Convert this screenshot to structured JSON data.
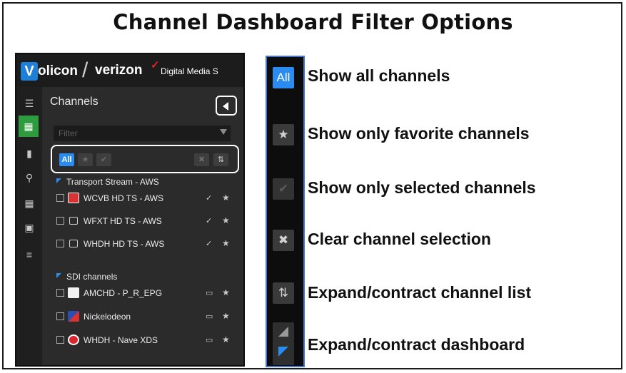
{
  "title": "Channel Dashboard Filter Options",
  "app": {
    "logo_v": "V",
    "logo_name": "olicon",
    "logo_slash": "/",
    "partner": "verizon",
    "partner_check": "✓",
    "product": "Digital Media S",
    "rail_icons": [
      "menu-icon",
      "film-icon",
      "bookmark-icon",
      "search-icon",
      "grid-icon",
      "share-icon",
      "list-icon"
    ],
    "panel_title": "Channels",
    "filter_placeholder": "Filter",
    "toolbar": {
      "all_label": "All",
      "star_glyph": "★",
      "check_glyph": "✔",
      "clear_glyph": "✖",
      "expand_glyph": "⇅"
    },
    "groups": [
      {
        "label": "Transport Stream - AWS",
        "channels": [
          {
            "label": "WCVB HD TS - AWS",
            "icon": "wcvb-logo-icon",
            "action": "✓"
          },
          {
            "label": "WFXT HD TS - AWS",
            "icon": "tv-icon",
            "action": "✓"
          },
          {
            "label": "WHDH HD TS - AWS",
            "icon": "tv-icon",
            "action": "✓"
          }
        ]
      },
      {
        "label": "SDI channels",
        "channels": [
          {
            "label": "AMCHD - P_R_EPG",
            "icon": "amc-logo-icon",
            "action": "▭"
          },
          {
            "label": "Nickelodeon",
            "icon": "nickelodeon-logo-icon",
            "action": "▭"
          },
          {
            "label": "WHDH - Nave XDS",
            "icon": "channel7-logo-icon",
            "action": "▭"
          }
        ]
      }
    ],
    "star": "★"
  },
  "legend": [
    {
      "icon": "all-button",
      "glyph": "All",
      "text": "Show all channels"
    },
    {
      "icon": "star-icon",
      "glyph": "★",
      "text": "Show only favorite channels"
    },
    {
      "icon": "check-icon",
      "glyph": "✔",
      "text": "Show only selected channels"
    },
    {
      "icon": "clear-selection-icon",
      "glyph": "✖",
      "text": "Clear channel selection"
    },
    {
      "icon": "expand-list-icon",
      "glyph": "⇅",
      "text": "Expand/contract channel list"
    },
    {
      "icon": "expand-dashboard-icon",
      "glyph": "",
      "text": "Expand/contract dashboard"
    }
  ],
  "colors": {
    "accent_blue": "#2a8cf0",
    "active_green": "#2e9b3e",
    "verizon_red": "#e0232b",
    "strip_border": "#4a76c8"
  }
}
